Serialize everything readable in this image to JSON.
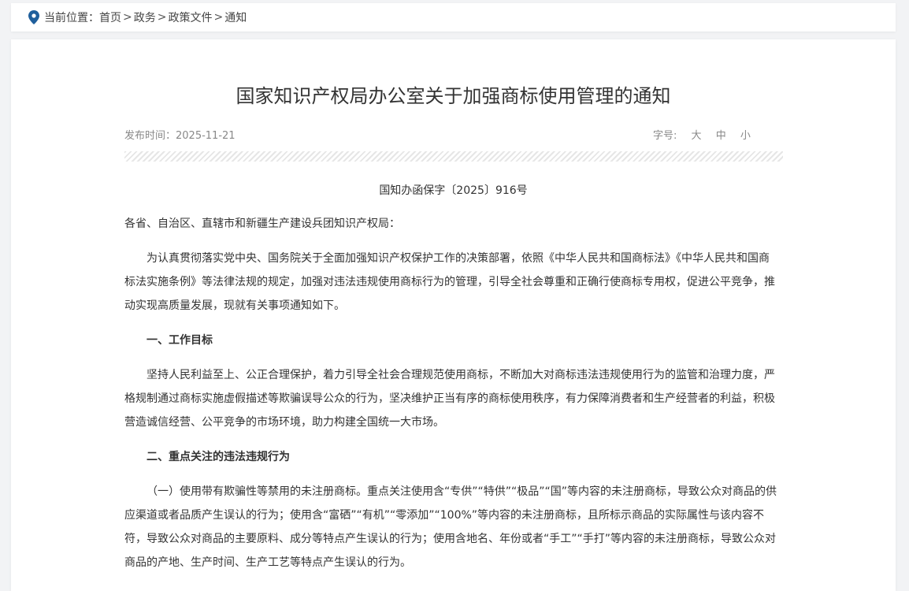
{
  "breadcrumb": {
    "prefix": "当前位置：",
    "items": [
      "首页",
      "政务",
      "政策文件",
      "通知"
    ],
    "separator": ">"
  },
  "article": {
    "title": "国家知识产权局办公室关于加强商标使用管理的通知",
    "publish_label": "发布时间：2025-11-21",
    "font_size_label": "字号:",
    "font_size_options": [
      "大",
      "中",
      "小"
    ],
    "doc_number": "国知办函保字〔2025〕916号",
    "addressee": "各省、自治区、直辖市和新疆生产建设兵团知识产权局：",
    "intro": "为认真贯彻落实党中央、国务院关于全面加强知识产权保护工作的决策部署，依照《中华人民共和国商标法》《中华人民共和国商标法实施条例》等法律法规的规定，加强对违法违规使用商标行为的管理，引导全社会尊重和正确行使商标专用权，促进公平竞争，推动实现高质量发展，现就有关事项通知如下。",
    "section1_heading": "一、工作目标",
    "section1_text": "坚持人民利益至上、公正合理保护，着力引导全社会合理规范使用商标，不断加大对商标违法违规使用行为的监管和治理力度，严格规制通过商标实施虚假描述等欺骗误导公众的行为，坚决维护正当有序的商标使用秩序，有力保障消费者和生产经营者的利益，积极营造诚信经营、公平竞争的市场环境，助力构建全国统一大市场。",
    "section2_heading": "二、重点关注的违法违规行为",
    "section2_item1": "（一）使用带有欺骗性等禁用的未注册商标。重点关注使用含“专供”“特供”“极品”“国”等内容的未注册商标，导致公众对商品的供应渠道或者品质产生误认的行为；使用含“富硒”“有机”“零添加”“100%”等内容的未注册商标，且所标示商品的实际属性与该内容不符，导致公众对商品的主要原料、成分等特点产生误认的行为；使用含地名、年份或者“手工”“手打”等内容的未注册商标，导致公众对商品的产地、生产时间、生产工艺等特点产生误认的行为。"
  },
  "colors": {
    "location_icon": "#1f5f9c",
    "page_bg": "#f2f3f5"
  },
  "icons": {
    "location": "location-pin-icon"
  }
}
